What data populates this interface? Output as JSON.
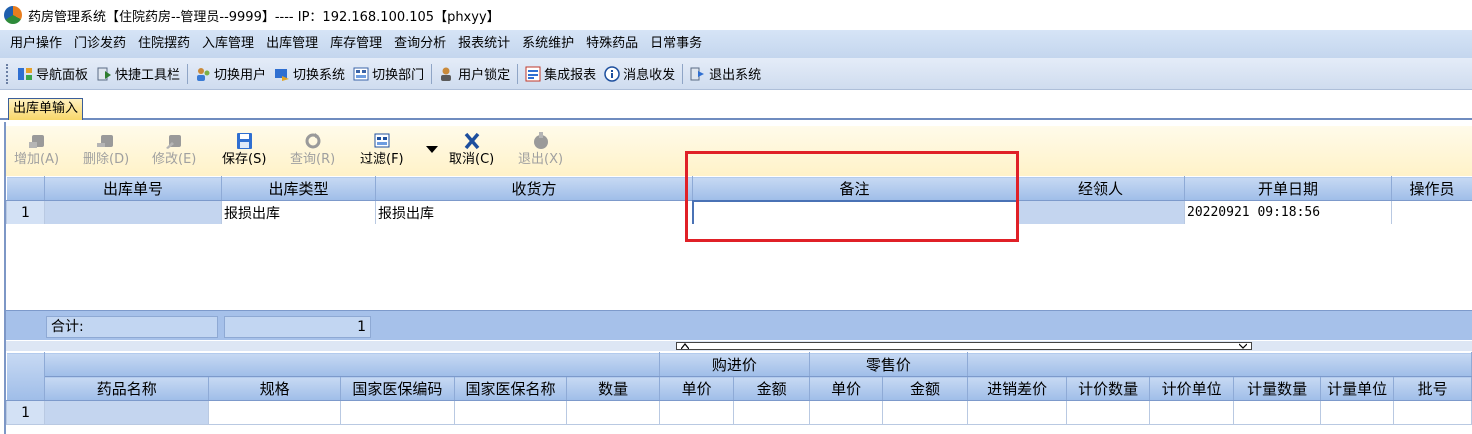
{
  "window": {
    "title": "药房管理系统【住院药房--管理员--9999】---- IP：192.168.100.105【phxyy】"
  },
  "menu": [
    "用户操作",
    "门诊发药",
    "住院摆药",
    "入库管理",
    "出库管理",
    "库存管理",
    "查询分析",
    "报表统计",
    "系统维护",
    "特殊药品",
    "日常事务"
  ],
  "toolbar": {
    "nav_panel": "导航面板",
    "quick_toolbar": "快捷工具栏",
    "switch_user": "切换用户",
    "switch_system": "切换系统",
    "switch_dept": "切换部门",
    "user_lock": "用户锁定",
    "integrated_report": "集成报表",
    "message": "消息收发",
    "exit_system": "退出系统"
  },
  "doc_tab": "出库单输入",
  "actions": {
    "add": "增加(A)",
    "delete": "删除(D)",
    "edit": "修改(E)",
    "save": "保存(S)",
    "query": "查询(R)",
    "filter": "过滤(F)",
    "cancel": "取消(C)",
    "exit": "退出(X)"
  },
  "master_grid": {
    "columns": [
      "出库单号",
      "出库类型",
      "收货方",
      "备注",
      "经领人",
      "开单日期",
      "操作员"
    ],
    "rows": [
      {
        "num": "1",
        "order_no": "",
        "type": "报损出库",
        "receiver": "报损出库",
        "remark": "",
        "handler": "",
        "date": "20220921 09:18:56",
        "operator": ""
      }
    ]
  },
  "summary": {
    "label": "合计:",
    "count": "1"
  },
  "detail_grid": {
    "group_headers": {
      "purchase": "购进价",
      "retail": "零售价"
    },
    "columns": [
      "药品名称",
      "规格",
      "国家医保编码",
      "国家医保名称",
      "数量",
      "单价",
      "金额",
      "单价",
      "金额",
      "进销差价",
      "计价数量",
      "计价单位",
      "计量数量",
      "计量单位",
      "批号"
    ],
    "rows": [
      {
        "num": "1"
      }
    ]
  }
}
